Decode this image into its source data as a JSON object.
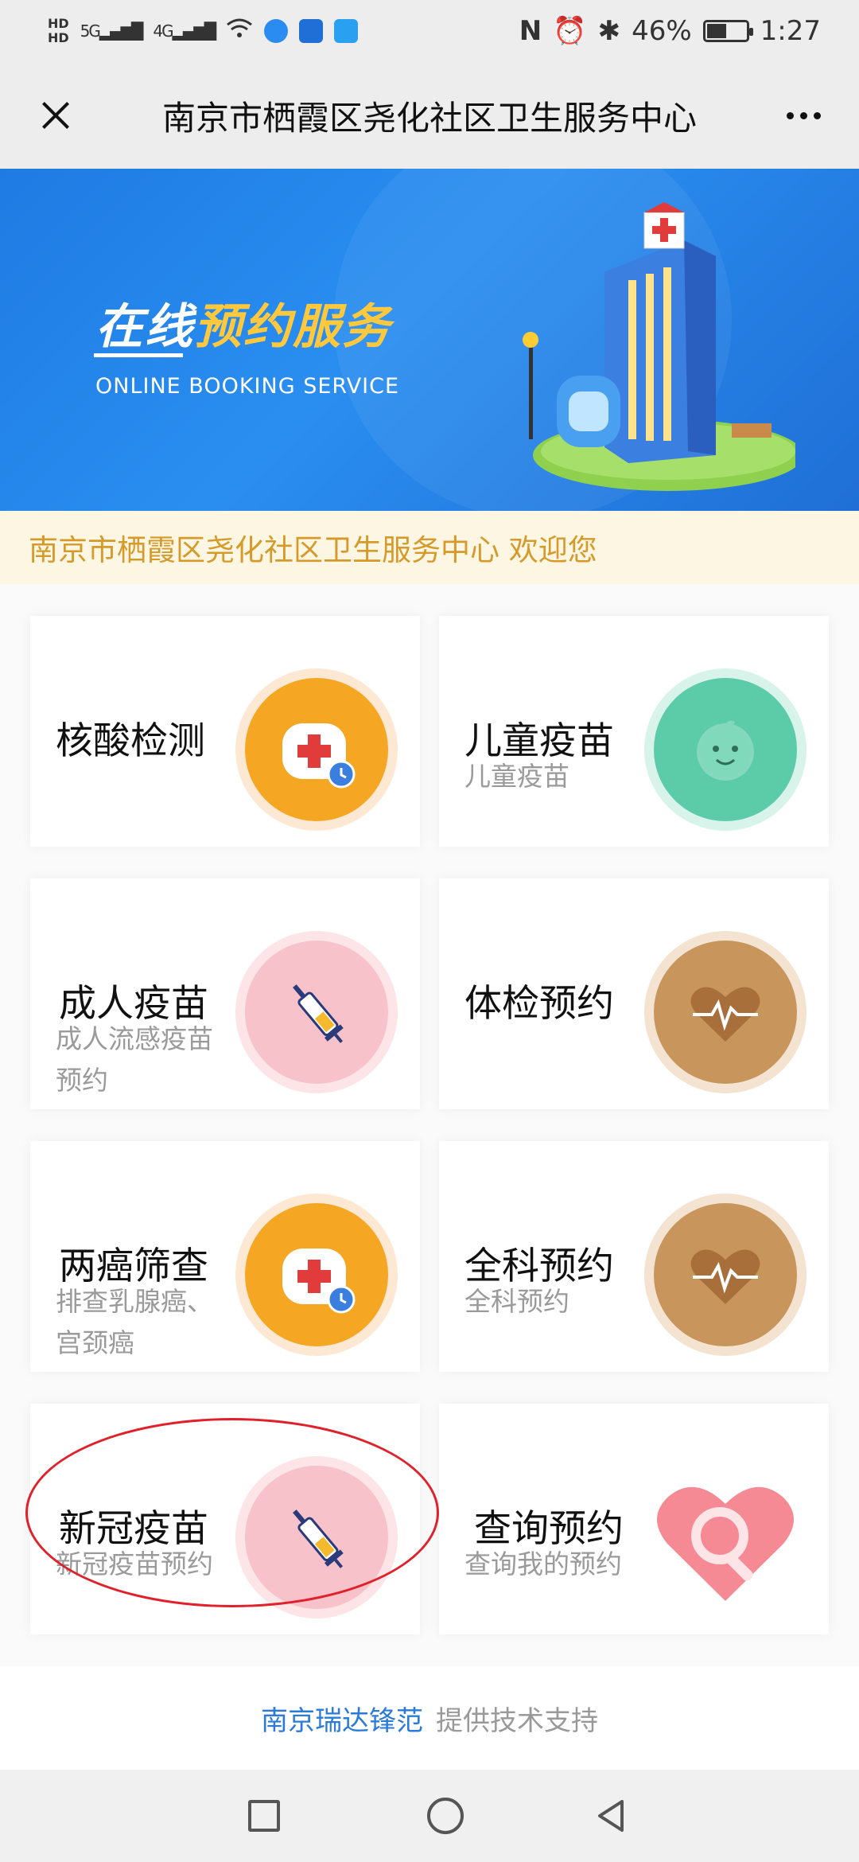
{
  "status_bar": {
    "network": "HD 5G 4G",
    "battery": "46%",
    "time": "1:27"
  },
  "title_bar": {
    "title": "南京市栖霞区尧化社区卫生服务中心"
  },
  "banner": {
    "title_part1": "在线",
    "title_part2": "预约服务",
    "subtitle": "ONLINE BOOKING SERVICE"
  },
  "welcome": {
    "text": "南京市栖霞区尧化社区卫生服务中心 欢迎您"
  },
  "services": [
    {
      "title": "核酸检测",
      "subtitle": "",
      "icon": "medical-kit-clock-icon"
    },
    {
      "title": "儿童疫苗",
      "subtitle": "儿童疫苗",
      "icon": "baby-face-icon"
    },
    {
      "title": "成人疫苗",
      "subtitle": "成人流感疫苗预约",
      "icon": "syringe-icon"
    },
    {
      "title": "体检预约",
      "subtitle": "",
      "icon": "heart-pulse-icon"
    },
    {
      "title": "两癌筛查",
      "subtitle": "排查乳腺癌、宫颈癌",
      "icon": "medical-kit-clock-icon"
    },
    {
      "title": "全科预约",
      "subtitle": "全科预约",
      "icon": "heart-pulse-icon"
    },
    {
      "title": "新冠疫苗",
      "subtitle": "新冠疫苗预约",
      "icon": "syringe-icon"
    },
    {
      "title": "查询预约",
      "subtitle": "查询我的预约",
      "icon": "heart-search-icon"
    }
  ],
  "footer": {
    "brand": "南京瑞达锋范",
    "support": "提供技术支持"
  },
  "colors": {
    "orange_icon": "#f5a623",
    "teal_icon": "#5ccba7",
    "pink_icon": "#f7b3bd",
    "brown_icon": "#c8955c",
    "annotation": "#e0202a",
    "link": "#2a7bd8"
  }
}
